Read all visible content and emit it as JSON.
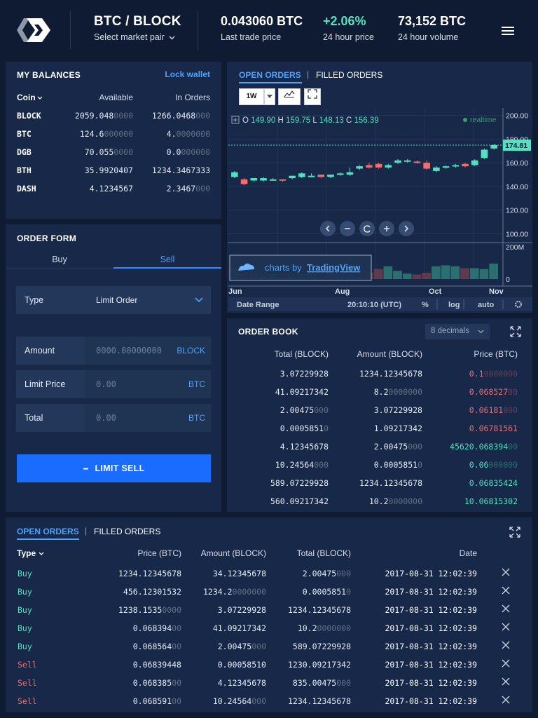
{
  "header": {
    "pair": "BTC / BLOCK",
    "select_label": "Select market pair",
    "last_trade_value": "0.043060 BTC",
    "last_trade_label": "Last trade price",
    "change_value": "+2.06%",
    "change_label": "24 hour price",
    "volume_value": "73,152 BTC",
    "volume_label": "24 hour volume"
  },
  "balances": {
    "title": "MY BALANCES",
    "lock_label": "Lock wallet",
    "col_coin": "Coin",
    "col_available": "Available",
    "col_in_orders": "In Orders",
    "rows": [
      {
        "coin": "BLOCK",
        "avail": "2059.048",
        "avail_dim": "0000",
        "orders": "1266.0468",
        "orders_dim": "000"
      },
      {
        "coin": "BTC",
        "avail": "124.6",
        "avail_dim": "000000",
        "orders": "4.",
        "orders_dim": "0000000"
      },
      {
        "coin": "DGB",
        "avail": "70.055",
        "avail_dim": "0000",
        "orders": "0.0",
        "orders_dim": "000000"
      },
      {
        "coin": "BTH",
        "avail": "35.9920407",
        "avail_dim": "",
        "orders": "1234.3467333",
        "orders_dim": ""
      },
      {
        "coin": "DASH",
        "avail": "4.1234567",
        "avail_dim": "",
        "orders": "2.3467",
        "orders_dim": "000"
      }
    ]
  },
  "order_form": {
    "title": "ORDER FORM",
    "tab_buy": "Buy",
    "tab_sell": "Sell",
    "type_label": "Type",
    "type_value": "Limit Order",
    "amount_label": "Amount",
    "amount_placeholder": "0000.00000000",
    "amount_unit": "BLOCK",
    "limit_label": "Limit Price",
    "limit_placeholder": "0.00",
    "limit_unit": "BTC",
    "total_label": "Total",
    "total_placeholder": "0.00",
    "total_unit": "BTC",
    "submit_label": "LIMIT SELL"
  },
  "chart_panel": {
    "tab_open": "OPEN ORDERS",
    "tab_filled": "FILLED ORDERS",
    "interval": "1W",
    "ohlc": {
      "o": "149.90",
      "h": "159.75",
      "l": "148.13",
      "c": "156.39"
    },
    "realtime": "realtime",
    "last_price_tag": "174.81",
    "brand_text": "charts by",
    "brand_name": "TradingView",
    "date_range": "Date Range",
    "clock": "20:10:10 (UTC)",
    "pct": "%",
    "log": "log",
    "auto": "auto",
    "volume_axis_top": "200M",
    "volume_axis_bottom": "0"
  },
  "chart_data": {
    "type": "candlestick",
    "x_ticks": [
      "Jun",
      "Aug",
      "Oct",
      "Nov"
    ],
    "y_ticks": [
      200,
      180,
      160,
      140,
      120,
      100
    ],
    "ylim": [
      95,
      205
    ],
    "candles": [
      {
        "o": 148,
        "c": 152,
        "h": 153,
        "l": 147
      },
      {
        "o": 146,
        "c": 142,
        "h": 147,
        "l": 141
      },
      {
        "o": 145,
        "c": 147,
        "h": 147,
        "l": 144
      },
      {
        "o": 145,
        "c": 147,
        "h": 148,
        "l": 144
      },
      {
        "o": 145,
        "c": 146,
        "h": 147,
        "l": 145
      },
      {
        "o": 146,
        "c": 145,
        "h": 146,
        "l": 144
      },
      {
        "o": 147,
        "c": 149,
        "h": 149,
        "l": 146
      },
      {
        "o": 148,
        "c": 151,
        "h": 152,
        "l": 147
      },
      {
        "o": 149,
        "c": 149,
        "h": 151,
        "l": 148
      },
      {
        "o": 150,
        "c": 148,
        "h": 150,
        "l": 147
      },
      {
        "o": 148,
        "c": 150,
        "h": 150,
        "l": 147
      },
      {
        "o": 150,
        "c": 151,
        "h": 152,
        "l": 149
      },
      {
        "o": 150,
        "c": 152,
        "h": 156,
        "l": 149
      },
      {
        "o": 155,
        "c": 157,
        "h": 158,
        "l": 154
      },
      {
        "o": 158,
        "c": 156,
        "h": 160,
        "l": 155
      },
      {
        "o": 159,
        "c": 156,
        "h": 160,
        "l": 155
      },
      {
        "o": 156,
        "c": 158,
        "h": 159,
        "l": 155
      },
      {
        "o": 160,
        "c": 162,
        "h": 163,
        "l": 159
      },
      {
        "o": 161,
        "c": 162,
        "h": 163,
        "l": 160
      },
      {
        "o": 161,
        "c": 160,
        "h": 162,
        "l": 159
      },
      {
        "o": 160,
        "c": 155,
        "h": 162,
        "l": 154
      },
      {
        "o": 153,
        "c": 156,
        "h": 157,
        "l": 152
      },
      {
        "o": 156,
        "c": 157,
        "h": 158,
        "l": 155
      },
      {
        "o": 157,
        "c": 158,
        "h": 159,
        "l": 156
      },
      {
        "o": 159,
        "c": 157,
        "h": 160,
        "l": 156
      },
      {
        "o": 158,
        "c": 162,
        "h": 163,
        "l": 157
      },
      {
        "o": 164,
        "c": 171,
        "h": 172,
        "l": 163
      },
      {
        "o": 172,
        "c": 174.81,
        "h": 176,
        "l": 171
      }
    ],
    "volume": [
      60,
      40,
      30,
      20,
      25,
      15,
      20,
      30,
      45,
      60,
      40,
      30,
      25,
      20,
      35,
      55,
      70,
      45,
      30,
      25,
      35,
      70,
      75,
      70,
      60,
      60,
      55,
      85
    ],
    "volume_ylim": [
      0,
      200
    ]
  },
  "order_book": {
    "title": "ORDER BOOK",
    "decimals": "8 decimals",
    "col_total": "Total (BLOCK)",
    "col_amount": "Amount (BLOCK)",
    "col_price": "Price (BTC)",
    "rows": [
      {
        "total": "3.07229928",
        "total_dim": "",
        "amount": "1234.12345678",
        "amount_dim": "",
        "price": "0.1",
        "price_dim": "0000000",
        "side": "sell"
      },
      {
        "total": "41.09217342",
        "total_dim": "",
        "amount": "8.2",
        "amount_dim": "0000000",
        "price": "0.068527",
        "price_dim": "00",
        "side": "sell"
      },
      {
        "total": "2.00475",
        "total_dim": "000",
        "amount": "3.07229928",
        "amount_dim": "",
        "price": "0.06181",
        "price_dim": "000",
        "side": "sell"
      },
      {
        "total": "0.0005851",
        "total_dim": "0",
        "amount": "1.09217342",
        "amount_dim": "",
        "price": "0.06781561",
        "price_dim": "",
        "side": "sell"
      },
      {
        "total": "4.12345678",
        "total_dim": "",
        "amount": "2.00475",
        "amount_dim": "000",
        "price": "45620.068394",
        "price_dim": "00",
        "side": "buy"
      },
      {
        "total": "10.24564",
        "total_dim": "000",
        "amount": "0.0005851",
        "amount_dim": "0",
        "price": "0.06",
        "price_dim": "000000",
        "side": "buy"
      },
      {
        "total": "589.07229928",
        "total_dim": "",
        "amount": "1234.12345678",
        "amount_dim": "",
        "price": "0.06835424",
        "price_dim": "",
        "side": "buy"
      },
      {
        "total": "560.09217342",
        "total_dim": "",
        "amount": "10.2",
        "amount_dim": "0000000",
        "price": "10.06815302",
        "price_dim": "",
        "side": "buy"
      }
    ]
  },
  "orders": {
    "tab_open": "OPEN ORDERS",
    "tab_filled": "FILLED ORDERS",
    "col_type": "Type",
    "col_price": "Price (BTC)",
    "col_amount": "Amount (BLOCK)",
    "col_total": "Total (BLOCK)",
    "col_date": "Date",
    "rows": [
      {
        "type": "Buy",
        "price": "1234.12345678",
        "price_dim": "",
        "amount": "34.12345678",
        "amount_dim": "",
        "total": "2.00475",
        "total_dim": "000",
        "date": "2017-08-31  12:02:39"
      },
      {
        "type": "Buy",
        "price": "456.12301532",
        "price_dim": "",
        "amount": "1234.2",
        "amount_dim": "0000000",
        "total": "0.0005851",
        "total_dim": "0",
        "date": "2017-08-31  12:02:39"
      },
      {
        "type": "Buy",
        "price": "1238.1535",
        "price_dim": "0000",
        "amount": "3.07229928",
        "amount_dim": "",
        "total": "1234.12345678",
        "total_dim": "",
        "date": "2017-08-31  12:02:39"
      },
      {
        "type": "Buy",
        "price": "0.068394",
        "price_dim": "00",
        "amount": "41.09217342",
        "amount_dim": "",
        "total": "10.2",
        "total_dim": "0000000",
        "date": "2017-08-31  12:02:39"
      },
      {
        "type": "Buy",
        "price": "0.068564",
        "price_dim": "00",
        "amount": "2.00475",
        "amount_dim": "000",
        "total": "589.07229928",
        "total_dim": "",
        "date": "2017-08-31  12:02:39"
      },
      {
        "type": "Sell",
        "price": "0.06839448",
        "price_dim": "",
        "amount": "0.00058510",
        "amount_dim": "",
        "total": "1230.09217342",
        "total_dim": "",
        "date": "2017-08-31  12:02:39"
      },
      {
        "type": "Sell",
        "price": "0.068385",
        "price_dim": "00",
        "amount": "4.12345678",
        "amount_dim": "",
        "total": "835.00475",
        "total_dim": "000",
        "date": "2017-08-31  12:02:39"
      },
      {
        "type": "Sell",
        "price": "0.068591",
        "price_dim": "00",
        "amount": "10.24564",
        "amount_dim": "000",
        "total": "1234.12345678",
        "total_dim": "",
        "date": "2017-08-31  12:02:39"
      }
    ]
  },
  "colors": {
    "background": "#0e1b33",
    "panel": "#172848",
    "accent": "#4da3ff",
    "buy": "#4fe3bf",
    "sell": "#ef6e6e",
    "button": "#1a6cff"
  }
}
